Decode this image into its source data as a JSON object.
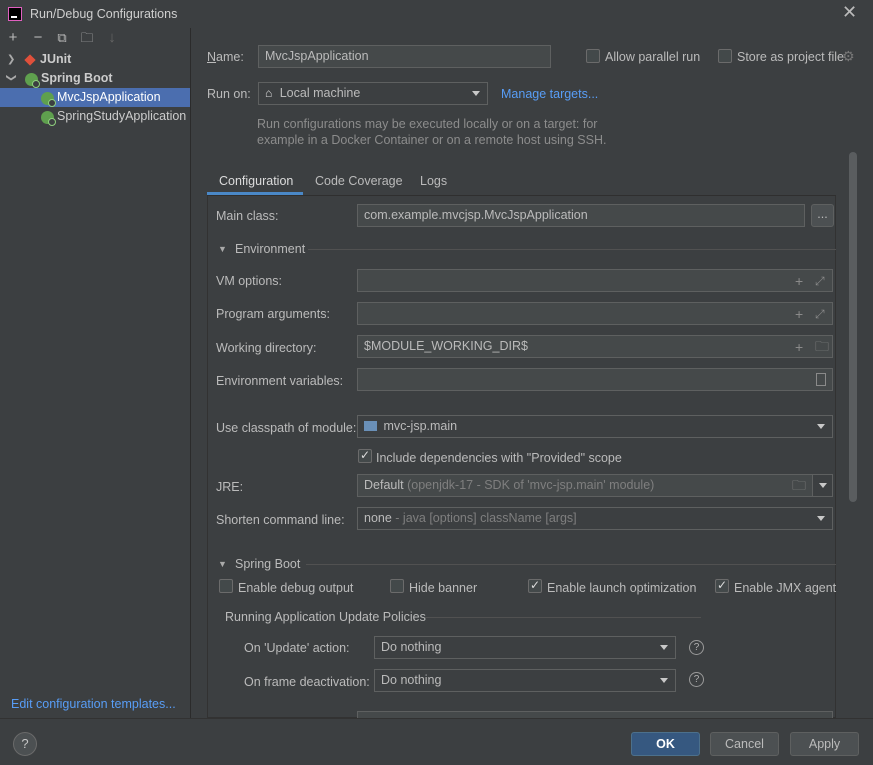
{
  "window": {
    "title": "Run/Debug Configurations"
  },
  "toolbar": {
    "add": "+",
    "remove": "−",
    "copy": "⧉",
    "new_folder": "🗀",
    "sort": "↓"
  },
  "tree": {
    "junit": "JUnit",
    "spring_boot": "Spring Boot",
    "items": [
      "MvcJspApplication",
      "SpringStudyApplication"
    ]
  },
  "edit_templates": "Edit configuration templates...",
  "header": {
    "name_label": "Name:",
    "name_value": "MvcJspApplication",
    "allow_parallel": "Allow parallel run",
    "store_project": "Store as project file",
    "run_on_label": "Run on:",
    "run_on_value": "Local machine",
    "manage_targets": "Manage targets...",
    "hint_line1": "Run configurations may be executed locally or on a target: for",
    "hint_line2": "example in a Docker Container or on a remote host using SSH."
  },
  "tabs": [
    "Configuration",
    "Code Coverage",
    "Logs"
  ],
  "config": {
    "main_class_label": "Main class:",
    "main_class_value": "com.example.mvcjsp.MvcJspApplication",
    "browse": "...",
    "environment_label": "Environment",
    "vm_options_label": "VM options:",
    "program_args_label": "Program arguments:",
    "working_dir_label": "Working directory:",
    "working_dir_value": "$MODULE_WORKING_DIR$",
    "env_vars_label": "Environment variables:",
    "classpath_label": "Use classpath of module:",
    "classpath_value": "mvc-jsp.main",
    "include_provided": "Include dependencies with \"Provided\" scope",
    "jre_label": "JRE:",
    "jre_value": "Default",
    "jre_detail": "(openjdk-17 - SDK of 'mvc-jsp.main' module)",
    "shorten_label": "Shorten command line:",
    "shorten_value": "none",
    "shorten_detail": "- java [options] className [args]"
  },
  "spring_boot": {
    "section_label": "Spring Boot",
    "enable_debug": "Enable debug output",
    "hide_banner": "Hide banner",
    "launch_opt": "Enable launch optimization",
    "jmx_agent": "Enable JMX agent",
    "policies_label": "Running Application Update Policies",
    "on_update_label": "On 'Update' action:",
    "on_update_value": "Do nothing",
    "on_frame_label": "On frame deactivation:",
    "on_frame_value": "Do nothing"
  },
  "buttons": {
    "ok": "OK",
    "cancel": "Cancel",
    "apply": "Apply",
    "help": "?"
  }
}
